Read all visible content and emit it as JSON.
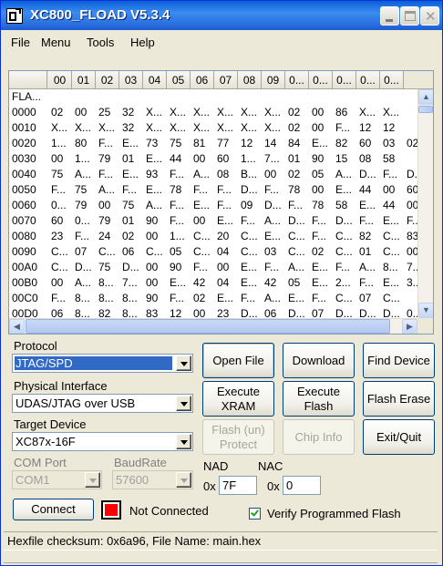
{
  "window": {
    "title": "XC800_FLOAD V5.3.4"
  },
  "menu": [
    "File",
    "Menu",
    "Tools",
    "Help"
  ],
  "grid": {
    "corner": "",
    "columns": [
      "00",
      "01",
      "02",
      "03",
      "04",
      "05",
      "06",
      "07",
      "08",
      "09",
      "0...",
      "0...",
      "0...",
      "0...",
      "0..."
    ],
    "header_row_label": "FLA...",
    "rows": [
      {
        "addr": "0000",
        "cells": [
          "02",
          "00",
          "25",
          "32",
          "X...",
          "X...",
          "X...",
          "X...",
          "X...",
          "X...",
          "02",
          "00",
          "86",
          "X...",
          "X..."
        ]
      },
      {
        "addr": "0010",
        "cells": [
          "X...",
          "X...",
          "X...",
          "32",
          "X...",
          "X...",
          "X...",
          "X...",
          "X...",
          "X...",
          "02",
          "00",
          "F...",
          "12",
          "12"
        ]
      },
      {
        "addr": "0020",
        "cells": [
          "1...",
          "80",
          "F...",
          "E...",
          "73",
          "75",
          "81",
          "77",
          "12",
          "14",
          "84",
          "E...",
          "82",
          "60",
          "03",
          "02"
        ]
      },
      {
        "addr": "0030",
        "cells": [
          "00",
          "1...",
          "79",
          "01",
          "E...",
          "44",
          "00",
          "60",
          "1...",
          "7...",
          "01",
          "90",
          "15",
          "08",
          "58"
        ]
      },
      {
        "addr": "0040",
        "cells": [
          "75",
          "A...",
          "F...",
          "E...",
          "93",
          "F...",
          "A...",
          "08",
          "B...",
          "00",
          "02",
          "05",
          "A...",
          "D...",
          "F...",
          "D..."
        ]
      },
      {
        "addr": "0050",
        "cells": [
          "F...",
          "75",
          "A...",
          "F...",
          "E...",
          "78",
          "F...",
          "F...",
          "D...",
          "F...",
          "78",
          "00",
          "E...",
          "44",
          "00",
          "60"
        ]
      },
      {
        "addr": "0060",
        "cells": [
          "0...",
          "79",
          "00",
          "75",
          "A...",
          "F...",
          "E...",
          "F...",
          "09",
          "D...",
          "F...",
          "78",
          "58",
          "E...",
          "44",
          "00"
        ]
      },
      {
        "addr": "0070",
        "cells": [
          "60",
          "0...",
          "79",
          "01",
          "90",
          "F...",
          "00",
          "E...",
          "F...",
          "A...",
          "D...",
          "F...",
          "D...",
          "F...",
          "E...",
          "F..."
        ]
      },
      {
        "addr": "0080",
        "cells": [
          "23",
          "F...",
          "24",
          "02",
          "00",
          "1...",
          "C...",
          "20",
          "C...",
          "E...",
          "C...",
          "F...",
          "C...",
          "82",
          "C...",
          "83"
        ]
      },
      {
        "addr": "0090",
        "cells": [
          "C...",
          "07",
          "C...",
          "06",
          "C...",
          "05",
          "C...",
          "04",
          "C...",
          "03",
          "C...",
          "02",
          "C...",
          "01",
          "C...",
          "00"
        ]
      },
      {
        "addr": "00A0",
        "cells": [
          "C...",
          "D...",
          "75",
          "D...",
          "00",
          "90",
          "F...",
          "00",
          "E...",
          "F...",
          "A...",
          "E...",
          "F...",
          "A...",
          "8...",
          "7..."
        ]
      },
      {
        "addr": "00B0",
        "cells": [
          "00",
          "A...",
          "8...",
          "7...",
          "00",
          "E...",
          "42",
          "04",
          "E...",
          "42",
          "05",
          "E...",
          "2...",
          "F...",
          "E...",
          "3..."
        ]
      },
      {
        "addr": "00C0",
        "cells": [
          "F...",
          "8...",
          "8...",
          "8...",
          "90",
          "F...",
          "02",
          "E...",
          "F...",
          "A...",
          "E...",
          "F...",
          "C...",
          "07",
          "C..."
        ]
      },
      {
        "addr": "00D0",
        "cells": [
          "06",
          "8...",
          "82",
          "8...",
          "83",
          "12",
          "00",
          "23",
          "D...",
          "06",
          "D...",
          "07",
          "D...",
          "D...",
          "D...",
          "0..."
        ]
      }
    ]
  },
  "protocol": {
    "label": "Protocol",
    "value": "JTAG/SPD"
  },
  "physical_interface": {
    "label": "Physical Interface",
    "value": "UDAS/JTAG over USB"
  },
  "target_device": {
    "label": "Target Device",
    "value": "XC87x-16F"
  },
  "com_port": {
    "label": "COM Port",
    "value": "COM1"
  },
  "baud_rate": {
    "label": "BaudRate",
    "value": "57600"
  },
  "buttons": {
    "open_file": "Open File",
    "download": "Download",
    "find_device": "Find Device",
    "execute_xram": "Execute XRAM",
    "execute_flash": "Execute Flash",
    "flash_erase": "Flash Erase",
    "flash_unprotect": "Flash (un) Protect",
    "chip_info": "Chip Info",
    "exit_quit": "Exit/Quit",
    "connect": "Connect"
  },
  "nad": {
    "label": "NAD",
    "prefix": "0x",
    "value": "7F"
  },
  "nac": {
    "label": "NAC",
    "prefix": "0x",
    "value": "0"
  },
  "connection_status": "Not Connected",
  "status_color": "#ff0000",
  "verify_checkbox": {
    "label": "Verify Programmed Flash",
    "checked": true
  },
  "statusbar": "Hexfile checksum: 0x6a96,  File Name: main.hex"
}
